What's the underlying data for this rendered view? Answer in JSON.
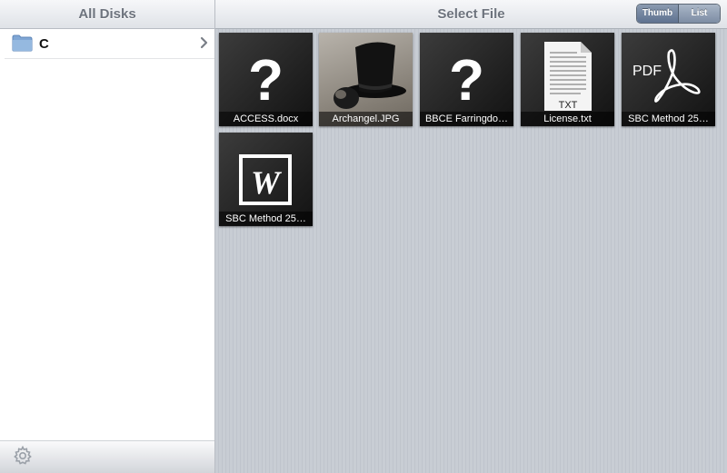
{
  "sidebar": {
    "title": "All Disks",
    "disks": [
      {
        "label": "C",
        "icon": "folder-icon"
      }
    ],
    "footer_icon": "gear-icon"
  },
  "main": {
    "title": "Select File",
    "view_toggle": {
      "options": [
        "Thumb",
        "List"
      ],
      "selected": "Thumb"
    },
    "files": [
      {
        "name": "ACCESS.docx",
        "icon": "unknown-file-icon"
      },
      {
        "name": "Archangel.JPG",
        "icon": "photo-thumbnail"
      },
      {
        "name": "BBCE Farringdo…",
        "icon": "unknown-file-icon"
      },
      {
        "name": "License.txt",
        "icon": "txt-file-icon"
      },
      {
        "name": "SBC Method 25…",
        "icon": "pdf-file-icon"
      },
      {
        "name": "SBC Method 25…",
        "icon": "word-file-icon"
      }
    ]
  },
  "colors": {
    "header_text": "#6d737d",
    "segment_active": "#5f7290",
    "pane_background": "#c5cad1",
    "folder_blue": "#7fa6d4"
  }
}
